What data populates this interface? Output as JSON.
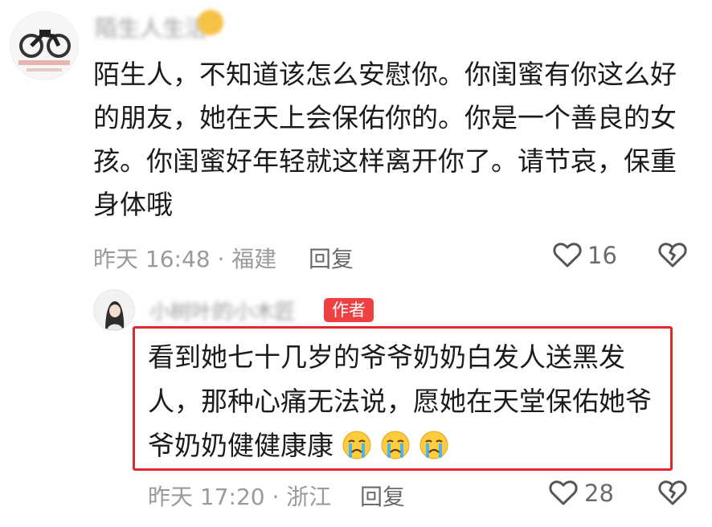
{
  "comment1": {
    "username": "陌生人生活",
    "text": "陌生人，不知道该怎么安慰你。你闺蜜有你这么好的朋友，她在天上会保佑你的。你是一个善良的女孩。你闺蜜好年轻就这样离开你了。请节哀，保重身体哦",
    "meta": "昨天 16:48 · 福建",
    "reply_label": "回复",
    "like_count": "16"
  },
  "comment2": {
    "username": "小树叶的小木匠",
    "author_badge": "作者",
    "text": "看到她七十几岁的爷爷奶奶白发人送黑发人，那种心痛无法说，愿她在天堂保佑她爷爷奶奶健健康康",
    "meta": "昨天 17:20 · 浙江",
    "reply_label": "回复",
    "like_count": "28",
    "emojis": [
      "crying-face",
      "crying-face",
      "crying-face"
    ]
  },
  "colors": {
    "highlight_border": "#e3262b",
    "author_badge_bg": "#f04142",
    "meta_text": "#9a9a9a"
  }
}
